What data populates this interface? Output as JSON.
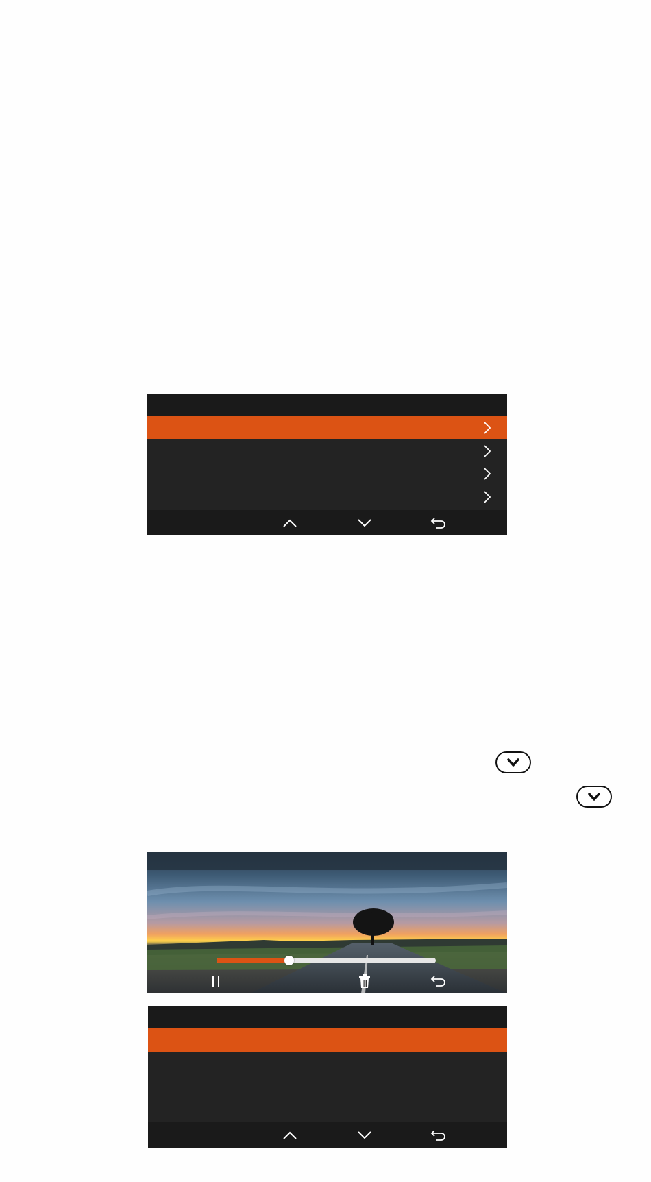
{
  "colors": {
    "accent": "#dc5314",
    "panel": "#232323",
    "bar": "#1a1a1a",
    "icon": "#ffffff"
  },
  "menu_screen": {
    "title": "",
    "rows": [
      {
        "label": "",
        "selected": true,
        "icon": "chevron-right-icon"
      },
      {
        "label": "",
        "selected": false,
        "icon": "chevron-right-icon"
      },
      {
        "label": "",
        "selected": false,
        "icon": "chevron-right-icon"
      },
      {
        "label": "",
        "selected": false,
        "icon": "chevron-right-icon"
      }
    ],
    "nav": [
      "up-arrow-icon",
      "down-arrow-icon",
      "back-icon"
    ]
  },
  "hardware_keys": [
    "down-key-icon",
    "down-key-icon"
  ],
  "playback_screen": {
    "background": "sunset-road-photo",
    "progress": 0.33,
    "controls": [
      "pause-icon",
      "trash-icon",
      "back-icon"
    ]
  },
  "list_screen": {
    "title": "",
    "rows": [
      {
        "label": "",
        "selected": true
      },
      {
        "label": "",
        "selected": false
      },
      {
        "label": "",
        "selected": false
      }
    ],
    "nav": [
      "up-arrow-icon",
      "down-arrow-icon",
      "back-icon"
    ]
  }
}
